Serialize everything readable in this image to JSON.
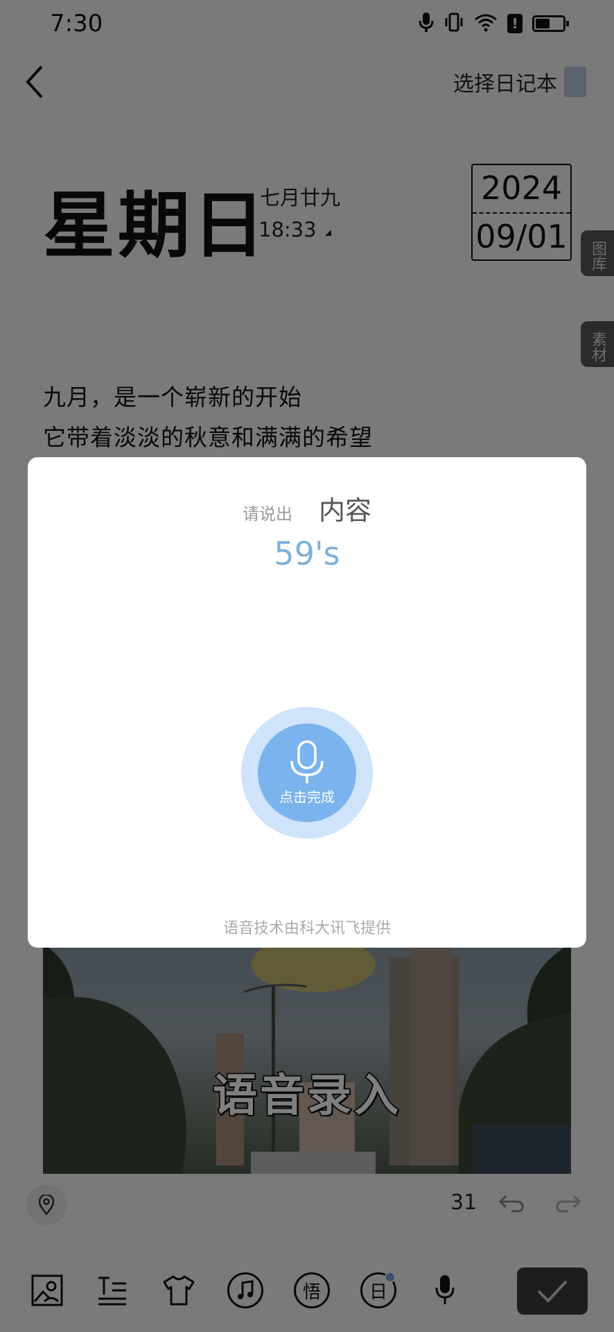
{
  "status_bar": {
    "time": "7:30"
  },
  "header": {
    "notebook_select_label": "选择日记本",
    "notebook_color": "#b9c7de"
  },
  "date": {
    "weekday": "星期日",
    "lunar": "七月廿九",
    "time": "18:33",
    "year": "2024",
    "month_day": "09/01"
  },
  "side_tabs": [
    {
      "label": "图库"
    },
    {
      "label": "素材"
    }
  ],
  "body": {
    "lines": [
      "九月，是一个崭新的开始",
      "它带着淡淡的秋意和满满的希望"
    ]
  },
  "photo": {
    "caption": "语音录入"
  },
  "meta": {
    "word_count": "31"
  },
  "toolbar": {
    "icons": [
      "image-icon",
      "text-format-icon",
      "tshirt-icon",
      "music-icon",
      "wu-icon",
      "ri-icon",
      "mic-icon"
    ],
    "wu_label": "悟",
    "ri_label": "日"
  },
  "voice_dialog": {
    "prompt_small": "请说出",
    "prompt_big": "内容",
    "timer": "59's",
    "mic_label": "点击完成",
    "credit": "语音技术由科大讯飞提供",
    "accent_color": "#7ab3ee"
  }
}
